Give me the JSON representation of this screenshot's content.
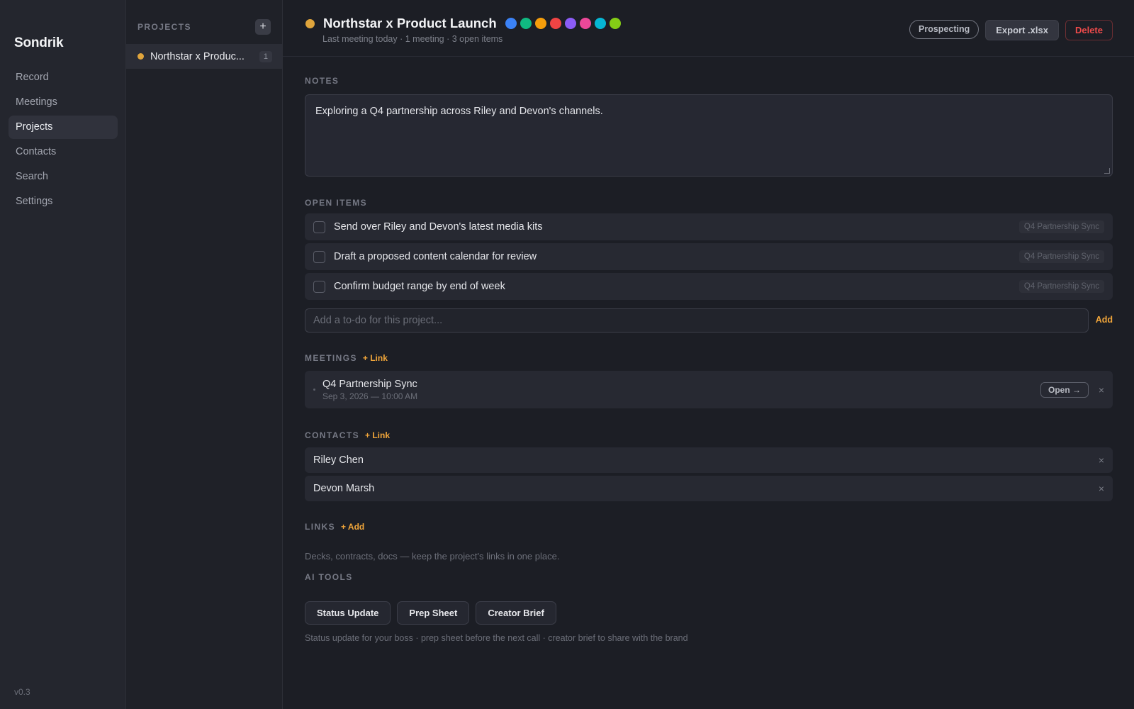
{
  "app": {
    "name": "Sondrik",
    "version": "v0.3"
  },
  "nav": {
    "items": [
      {
        "label": "Record"
      },
      {
        "label": "Meetings"
      },
      {
        "label": "Projects",
        "active": true
      },
      {
        "label": "Contacts"
      },
      {
        "label": "Search"
      },
      {
        "label": "Settings"
      }
    ]
  },
  "projects_panel": {
    "heading": "PROJECTS",
    "add_icon": "plus-icon",
    "add_glyph": "+",
    "items": [
      {
        "name": "Northstar x Produc...",
        "count": "1",
        "color": "#e0a53c"
      }
    ]
  },
  "project": {
    "title": "Northstar x Product Launch",
    "color": "#e0a53c",
    "subtitle": "Last meeting today · 1 meeting · 3 open items",
    "color_options": [
      "#3b82f6",
      "#10b981",
      "#f59e0b",
      "#ef4444",
      "#8b5cf6",
      "#ec4899",
      "#06b6d4",
      "#84cc16"
    ],
    "status_label": "Prospecting",
    "export_label": "Export .xlsx",
    "delete_label": "Delete"
  },
  "notes": {
    "heading": "NOTES",
    "text": "Exploring a Q4 partnership across Riley and Devon's channels."
  },
  "open_items": {
    "heading": "OPEN ITEMS",
    "items": [
      {
        "text": "Send over Riley and Devon's latest media kits",
        "tag": "Q4 Partnership Sync"
      },
      {
        "text": "Draft a proposed content calendar for review",
        "tag": "Q4 Partnership Sync"
      },
      {
        "text": "Confirm budget range by end of week",
        "tag": "Q4 Partnership Sync"
      }
    ],
    "input_placeholder": "Add a to-do for this project...",
    "add_label": "Add"
  },
  "meetings": {
    "heading": "MEETINGS",
    "link_label": "+ Link",
    "items": [
      {
        "title": "Q4 Partnership Sync",
        "date": "Sep 3, 2026 — 10:00 AM",
        "open_label": "Open →",
        "remove_glyph": "×"
      }
    ]
  },
  "contacts": {
    "heading": "CONTACTS",
    "link_label": "+ Link",
    "items": [
      {
        "name": "Riley Chen",
        "remove_glyph": "×"
      },
      {
        "name": "Devon Marsh",
        "remove_glyph": "×"
      }
    ]
  },
  "links": {
    "heading": "LINKS",
    "add_label": "+ Add",
    "hint": "Decks, contracts, docs — keep the project's links in one place."
  },
  "ai_tools": {
    "heading": "AI TOOLS",
    "buttons": [
      {
        "label": "Status Update"
      },
      {
        "label": "Prep Sheet"
      },
      {
        "label": "Creator Brief"
      }
    ],
    "hint": "Status update for your boss · prep sheet before the next call · creator brief to share with the brand"
  }
}
